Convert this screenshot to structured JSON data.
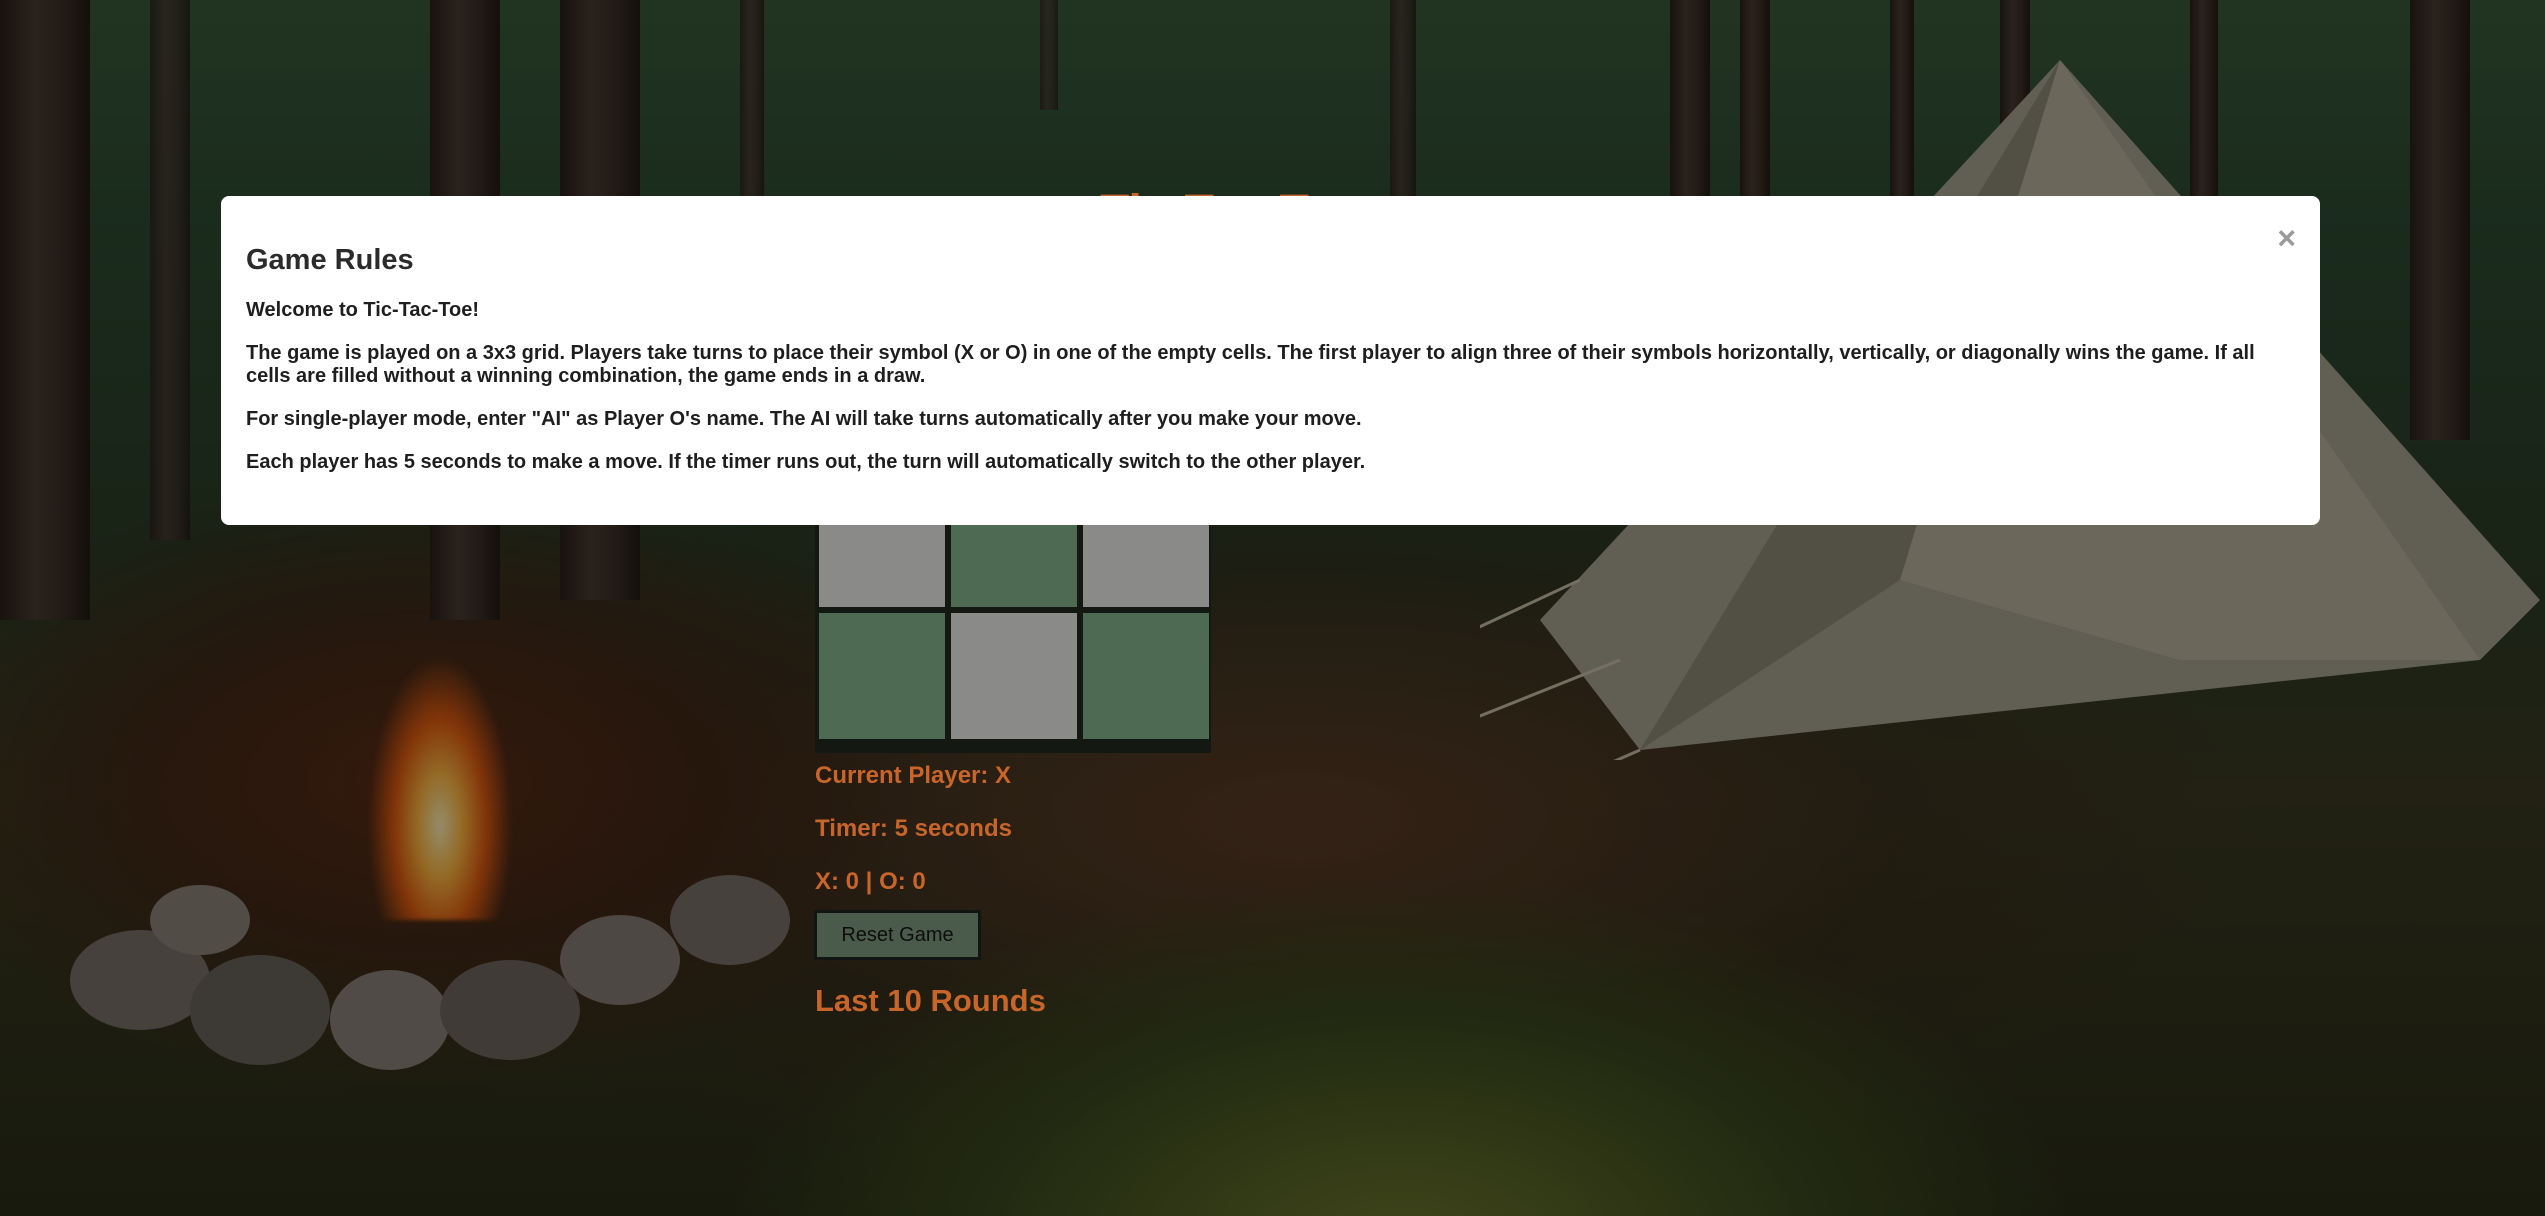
{
  "game": {
    "title": "Tic-Tac-Toe",
    "board": [
      "",
      "",
      "",
      "",
      "",
      "",
      "",
      "",
      ""
    ],
    "current_player": "Current Player: X",
    "timer": "Timer: 5 seconds",
    "score": "X: 0 | O: 0",
    "reset_label": "Reset Game",
    "history_title": "Last 10 Rounds"
  },
  "modal": {
    "title": "Game Rules",
    "close_symbol": "×",
    "paragraphs": [
      "Welcome to Tic-Tac-Toe!",
      "The game is played on a 3x3 grid. Players take turns to place their symbol (X or O) in one of the empty cells. The first player to align three of their symbols horizontally, vertically, or diagonally wins the game. If all cells are filled without a winning combination, the game ends in a draw.",
      "For single-player mode, enter \"AI\" as Player O's name. The AI will take turns automatically after you make your move.",
      "Each player has 5 seconds to make a move. If the timer runs out, the turn will automatically switch to the other player."
    ]
  },
  "colors": {
    "accent": "#c7652a",
    "cell_light": "#8a8a88",
    "cell_green": "#4e6a52",
    "button_bg": "#4b5b4b"
  }
}
